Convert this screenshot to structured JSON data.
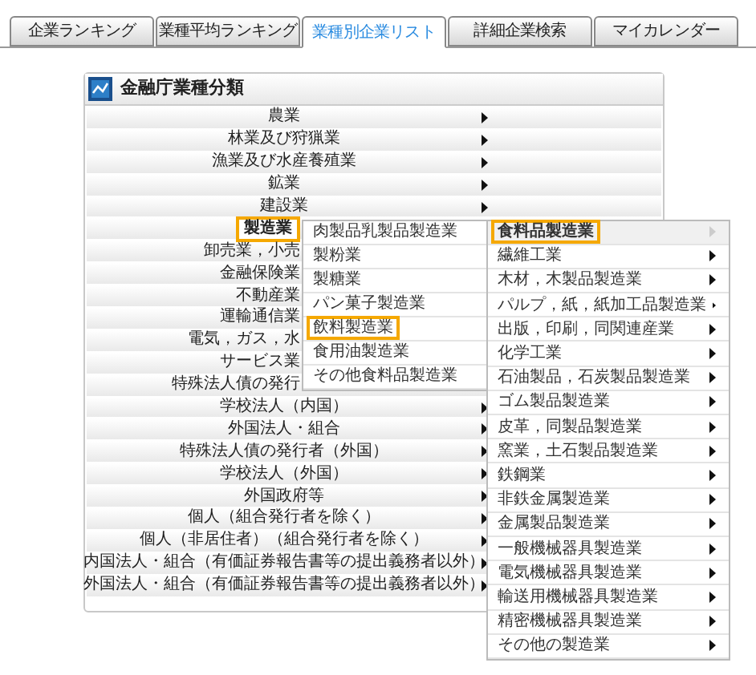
{
  "tabs": [
    {
      "label": "企業ランキング",
      "selected": false
    },
    {
      "label": "業種平均ランキング",
      "selected": false
    },
    {
      "label": "業種別企業リスト",
      "selected": true
    },
    {
      "label": "詳細企業検索",
      "selected": false
    },
    {
      "label": "マイカレンダー",
      "selected": false
    }
  ],
  "panel": {
    "title": "金融庁業種分類",
    "items": [
      {
        "label": "農業",
        "selected": false
      },
      {
        "label": "林業及び狩猟業",
        "selected": false
      },
      {
        "label": "漁業及び水産養殖業",
        "selected": false
      },
      {
        "label": "鉱業",
        "selected": false
      },
      {
        "label": "建設業",
        "selected": false
      },
      {
        "label": "製造業",
        "selected": true
      },
      {
        "label": "卸売業，小売",
        "selected": false
      },
      {
        "label": "金融保険業",
        "selected": false
      },
      {
        "label": "不動産業",
        "selected": false
      },
      {
        "label": "運輸通信業",
        "selected": false
      },
      {
        "label": "電気，ガス，水",
        "selected": false
      },
      {
        "label": "サービス業",
        "selected": false
      },
      {
        "label": "特殊法人債の発行",
        "selected": false
      },
      {
        "label": "学校法人（内国）",
        "selected": false
      },
      {
        "label": "外国法人・組合",
        "selected": false
      },
      {
        "label": "特殊法人債の発行者（外国）",
        "selected": false
      },
      {
        "label": "学校法人（外国）",
        "selected": false
      },
      {
        "label": "外国政府等",
        "selected": false
      },
      {
        "label": "個人（組合発行者を除く）",
        "selected": false
      },
      {
        "label": "個人（非居住者）（組合発行者を除く）",
        "selected": false
      },
      {
        "label": "内国法人・組合（有価証券報告書等の提出義務者以外）",
        "selected": false
      },
      {
        "label": "外国法人・組合（有価証券報告書等の提出義務者以外）",
        "selected": false
      }
    ]
  },
  "submenu": {
    "items": [
      {
        "label": "肉製品乳製品製造業",
        "selected": false
      },
      {
        "label": "製粉業",
        "selected": false
      },
      {
        "label": "製糖業",
        "selected": false
      },
      {
        "label": "パン菓子製造業",
        "selected": false
      },
      {
        "label": "飲料製造業",
        "selected": true
      },
      {
        "label": "食用油製造業",
        "selected": false
      },
      {
        "label": "その他食料品製造業",
        "selected": false
      }
    ]
  },
  "submenu_2": {
    "items": [
      {
        "label": "食料品製造業",
        "selected": true
      },
      {
        "label": "繊維工業",
        "selected": false
      },
      {
        "label": "木材，木製品製造業",
        "selected": false
      },
      {
        "label": "パルプ，紙，紙加工品製造業",
        "selected": false
      },
      {
        "label": "出版，印刷，同関連産業",
        "selected": false
      },
      {
        "label": "化学工業",
        "selected": false
      },
      {
        "label": "石油製品，石炭製品製造業",
        "selected": false
      },
      {
        "label": "ゴム製品製造業",
        "selected": false
      },
      {
        "label": "皮革，同製品製造業",
        "selected": false
      },
      {
        "label": "窯業，土石製品製造業",
        "selected": false
      },
      {
        "label": "鉄鋼業",
        "selected": false
      },
      {
        "label": "非鉄金属製造業",
        "selected": false
      },
      {
        "label": "金属製品製造業",
        "selected": false
      },
      {
        "label": "一般機械器具製造業",
        "selected": false
      },
      {
        "label": "電気機械器具製造業",
        "selected": false
      },
      {
        "label": "輸送用機械器具製造業",
        "selected": false
      },
      {
        "label": "精密機械器具製造業",
        "selected": false
      },
      {
        "label": "その他の製造業",
        "selected": false
      }
    ]
  }
}
